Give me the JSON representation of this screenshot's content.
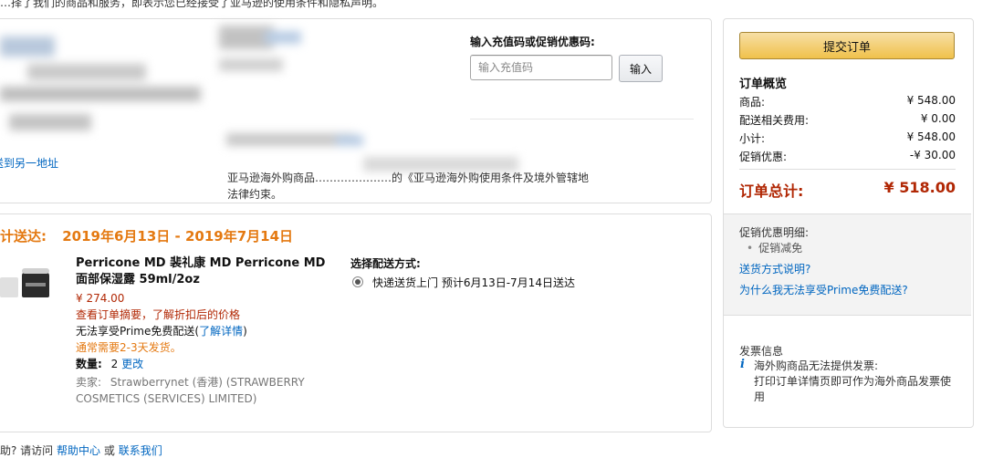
{
  "top_notice": "…择了我们的商品和服务，即表示您已经接受了亚马逊的使用条件和隐私声明。",
  "address": {
    "change_link": "送到另一地址",
    "notice_line1": "亚马逊海外购商品…………………的《亚马逊海外购使用条件及境外管辖地",
    "notice_line2": "法律约束。"
  },
  "coupon": {
    "label": "输入充值码或促销优惠码:",
    "placeholder": "输入充值码",
    "button": "输入"
  },
  "shipment": {
    "delivery_prefix": "计送达:",
    "delivery_range": "2019年6月13日 - 2019年7月14日",
    "item": {
      "title": "Perricone MD 裴礼康 MD Perricone MD 面部保湿露 59ml/2oz",
      "price": "¥ 274.00",
      "discount_note": "查看订单摘要，了解折扣后的价格",
      "prime_text": "无法享受Prime免费配送",
      "prime_link": "了解详情",
      "ship_note": "通常需要2-3天发货。",
      "qty_label": "数量:",
      "qty_value": "2",
      "qty_change": "更改",
      "seller_label": "卖家:",
      "seller": "Strawberrynet (香港) (STRAWBERRY COSMETICS (SERVICES) LIMITED)"
    },
    "shipping_method_label": "选择配送方式:",
    "shipping_option": "快递送货上门 预计6月13日-7月14日送达"
  },
  "help": {
    "prefix": "助? 请访问",
    "help_center": "帮助中心",
    "or": "或",
    "contact": "联系我们"
  },
  "summary": {
    "submit_button": "提交订单",
    "title": "订单概览",
    "rows": [
      {
        "label": "商品:",
        "value": "¥ 548.00"
      },
      {
        "label": "配送相关费用:",
        "value": "¥ 0.00"
      },
      {
        "label": "小计:",
        "value": "¥ 548.00"
      },
      {
        "label": "促销优惠:",
        "value": "-¥ 30.00"
      }
    ],
    "total_label": "订单总计:",
    "total_value": "¥ 518.00",
    "promo_detail_title": "促销优惠明细:",
    "promo_item": "促销减免",
    "link_shipping": "送货方式说明?",
    "link_prime": "为什么我无法享受Prime免费配送?",
    "invoice_title": "发票信息",
    "invoice_line1": "海外购商品无法提供发票:",
    "invoice_line2": "打印订单详情页即可作为海外商品发票使用"
  },
  "colors": {
    "accent_orange": "#e47911",
    "price_red": "#b12704",
    "link_blue": "#0066c0",
    "button_yellow": "#f0c14b"
  }
}
